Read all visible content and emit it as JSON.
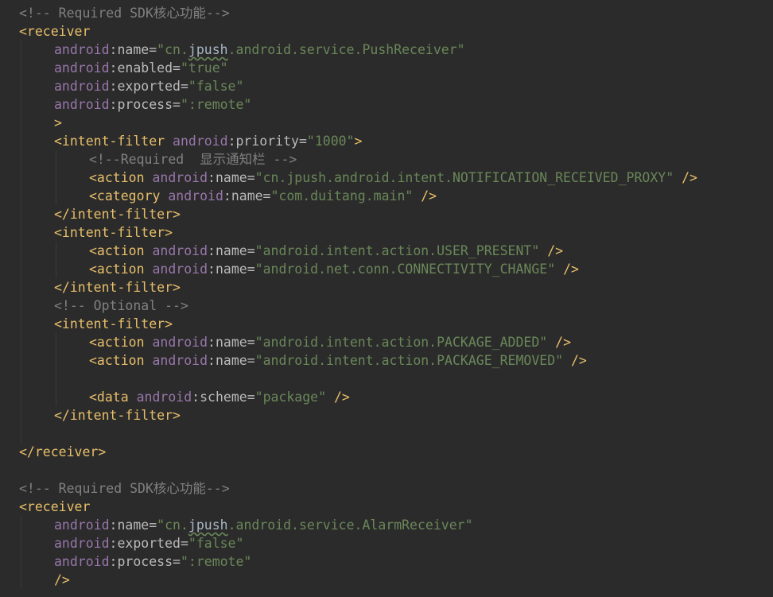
{
  "editor": {
    "file_type": "xml",
    "colors": {
      "background": "#2b2b2b",
      "comment": "#808080",
      "tag": "#e8bf6a",
      "namespace": "#9876aa",
      "attribute": "#bababa",
      "value": "#6a8759"
    },
    "lines": [
      {
        "indent": 0,
        "tokens": [
          {
            "t": "comment",
            "v": "<!-- Required SDK核心功能-->"
          }
        ]
      },
      {
        "indent": 0,
        "tokens": [
          {
            "t": "tag",
            "v": "<receiver"
          }
        ]
      },
      {
        "indent": 1,
        "tokens": [
          {
            "t": "ns",
            "v": "android"
          },
          {
            "t": "eq",
            "v": ":name="
          },
          {
            "t": "val",
            "v": "\"cn."
          },
          {
            "t": "typo",
            "v": "jpush"
          },
          {
            "t": "val",
            "v": ".android.service.PushReceiver\""
          }
        ]
      },
      {
        "indent": 1,
        "tokens": [
          {
            "t": "ns",
            "v": "android"
          },
          {
            "t": "eq",
            "v": ":enabled="
          },
          {
            "t": "val",
            "v": "\"true\""
          }
        ]
      },
      {
        "indent": 1,
        "tokens": [
          {
            "t": "ns",
            "v": "android"
          },
          {
            "t": "eq",
            "v": ":exported="
          },
          {
            "t": "val",
            "v": "\"false\""
          }
        ]
      },
      {
        "indent": 1,
        "tokens": [
          {
            "t": "ns",
            "v": "android"
          },
          {
            "t": "eq",
            "v": ":process="
          },
          {
            "t": "val",
            "v": "\":remote\""
          }
        ]
      },
      {
        "indent": 1,
        "tokens": [
          {
            "t": "tag",
            "v": ">"
          }
        ]
      },
      {
        "indent": 1,
        "tokens": [
          {
            "t": "tag",
            "v": "<intent-filter "
          },
          {
            "t": "ns",
            "v": "android"
          },
          {
            "t": "eq",
            "v": ":priority="
          },
          {
            "t": "val",
            "v": "\"1000\""
          },
          {
            "t": "tag",
            "v": ">"
          }
        ]
      },
      {
        "indent": 2,
        "tokens": [
          {
            "t": "comment",
            "v": "<!--Required  显示通知栏 -->"
          }
        ]
      },
      {
        "indent": 2,
        "tokens": [
          {
            "t": "tag",
            "v": "<action "
          },
          {
            "t": "ns",
            "v": "android"
          },
          {
            "t": "eq",
            "v": ":name="
          },
          {
            "t": "val",
            "v": "\"cn.jpush.android.intent.NOTIFICATION_RECEIVED_PROXY\""
          },
          {
            "t": "tag",
            "v": " />"
          }
        ]
      },
      {
        "indent": 2,
        "tokens": [
          {
            "t": "tag",
            "v": "<category "
          },
          {
            "t": "ns",
            "v": "android"
          },
          {
            "t": "eq",
            "v": ":name="
          },
          {
            "t": "val",
            "v": "\"com.duitang.main\""
          },
          {
            "t": "tag",
            "v": " />"
          }
        ]
      },
      {
        "indent": 1,
        "tokens": [
          {
            "t": "tag",
            "v": "</intent-filter>"
          }
        ]
      },
      {
        "indent": 1,
        "tokens": [
          {
            "t": "tag",
            "v": "<intent-filter>"
          }
        ]
      },
      {
        "indent": 2,
        "tokens": [
          {
            "t": "tag",
            "v": "<action "
          },
          {
            "t": "ns",
            "v": "android"
          },
          {
            "t": "eq",
            "v": ":name="
          },
          {
            "t": "val",
            "v": "\"android.intent.action.USER_PRESENT\""
          },
          {
            "t": "tag",
            "v": " />"
          }
        ]
      },
      {
        "indent": 2,
        "tokens": [
          {
            "t": "tag",
            "v": "<action "
          },
          {
            "t": "ns",
            "v": "android"
          },
          {
            "t": "eq",
            "v": ":name="
          },
          {
            "t": "val",
            "v": "\"android.net.conn.CONNECTIVITY_CHANGE\""
          },
          {
            "t": "tag",
            "v": " />"
          }
        ]
      },
      {
        "indent": 1,
        "tokens": [
          {
            "t": "tag",
            "v": "</intent-filter>"
          }
        ]
      },
      {
        "indent": 1,
        "tokens": [
          {
            "t": "comment",
            "v": "<!-- Optional -->"
          }
        ]
      },
      {
        "indent": 1,
        "tokens": [
          {
            "t": "tag",
            "v": "<intent-filter>"
          }
        ]
      },
      {
        "indent": 2,
        "tokens": [
          {
            "t": "tag",
            "v": "<action "
          },
          {
            "t": "ns",
            "v": "android"
          },
          {
            "t": "eq",
            "v": ":name="
          },
          {
            "t": "val",
            "v": "\"android.intent.action.PACKAGE_ADDED\""
          },
          {
            "t": "tag",
            "v": " />"
          }
        ]
      },
      {
        "indent": 2,
        "tokens": [
          {
            "t": "tag",
            "v": "<action "
          },
          {
            "t": "ns",
            "v": "android"
          },
          {
            "t": "eq",
            "v": ":name="
          },
          {
            "t": "val",
            "v": "\"android.intent.action.PACKAGE_REMOVED\""
          },
          {
            "t": "tag",
            "v": " />"
          }
        ]
      },
      {
        "indent": 2,
        "tokens": []
      },
      {
        "indent": 2,
        "tokens": [
          {
            "t": "tag",
            "v": "<data "
          },
          {
            "t": "ns",
            "v": "android"
          },
          {
            "t": "eq",
            "v": ":scheme="
          },
          {
            "t": "val",
            "v": "\"package\""
          },
          {
            "t": "tag",
            "v": " />"
          }
        ]
      },
      {
        "indent": 1,
        "tokens": [
          {
            "t": "tag",
            "v": "</intent-filter>"
          }
        ]
      },
      {
        "indent": 0,
        "tokens": []
      },
      {
        "indent": 0,
        "tokens": [
          {
            "t": "tag",
            "v": "</receiver>"
          }
        ]
      },
      {
        "indent": 0,
        "tokens": []
      },
      {
        "indent": 0,
        "tokens": [
          {
            "t": "comment",
            "v": "<!-- Required SDK核心功能-->"
          }
        ]
      },
      {
        "indent": 0,
        "tokens": [
          {
            "t": "tag",
            "v": "<receiver"
          }
        ]
      },
      {
        "indent": 1,
        "tokens": [
          {
            "t": "ns",
            "v": "android"
          },
          {
            "t": "eq",
            "v": ":name="
          },
          {
            "t": "val",
            "v": "\"cn."
          },
          {
            "t": "typo",
            "v": "jpush"
          },
          {
            "t": "val",
            "v": ".android.service.AlarmReceiver\""
          }
        ]
      },
      {
        "indent": 1,
        "tokens": [
          {
            "t": "ns",
            "v": "android"
          },
          {
            "t": "eq",
            "v": ":exported="
          },
          {
            "t": "val",
            "v": "\"false\""
          }
        ]
      },
      {
        "indent": 1,
        "tokens": [
          {
            "t": "ns",
            "v": "android"
          },
          {
            "t": "eq",
            "v": ":process="
          },
          {
            "t": "val",
            "v": "\":remote\""
          }
        ]
      },
      {
        "indent": 1,
        "tokens": [
          {
            "t": "tag",
            "v": "/>"
          }
        ]
      }
    ]
  }
}
